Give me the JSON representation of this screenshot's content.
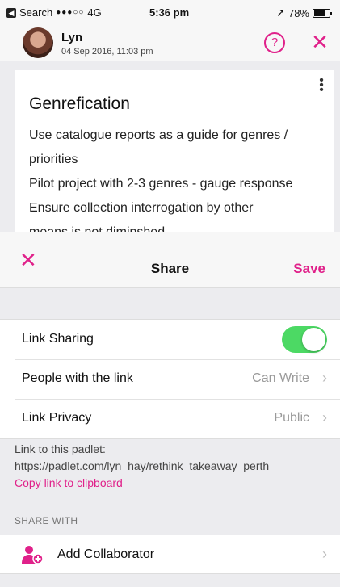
{
  "status_bar": {
    "back_app": "Search",
    "signal": "●●●○○",
    "network": "4G",
    "time": "5:36 pm",
    "battery": "78%",
    "battery_level": 0.78
  },
  "post": {
    "author": "Lyn",
    "date": "04 Sep 2016, 11:03 pm",
    "title": "Genrefication",
    "lines": [
      "Use catalogue reports as a guide for genres /",
      "priorities",
      "Pilot project with 2-3 genres - gauge response",
      "Ensure collection interrogation by other",
      "means is not diminshed"
    ]
  },
  "share": {
    "title": "Share",
    "save_label": "Save",
    "rows": [
      {
        "label": "Link Sharing",
        "toggle_on": true
      },
      {
        "label": "People with the link",
        "value": "Can Write"
      },
      {
        "label": "Link Privacy",
        "value": "Public"
      }
    ],
    "link_heading": "Link to this padlet:",
    "link_url": "https://padlet.com/lyn_hay/rethink_takeaway_perth",
    "copy_label": "Copy link to clipboard",
    "share_with_heading": "SHARE WITH",
    "add_collaborator_label": "Add Collaborator"
  },
  "icons": {
    "help": "question-circle-icon",
    "close": "close-icon",
    "more": "kebab-menu-icon",
    "add_collaborator": "add-person-icon",
    "chevron": "chevron-right-icon"
  },
  "colors": {
    "accent": "#e0218a",
    "toggle_on": "#4cd964"
  }
}
